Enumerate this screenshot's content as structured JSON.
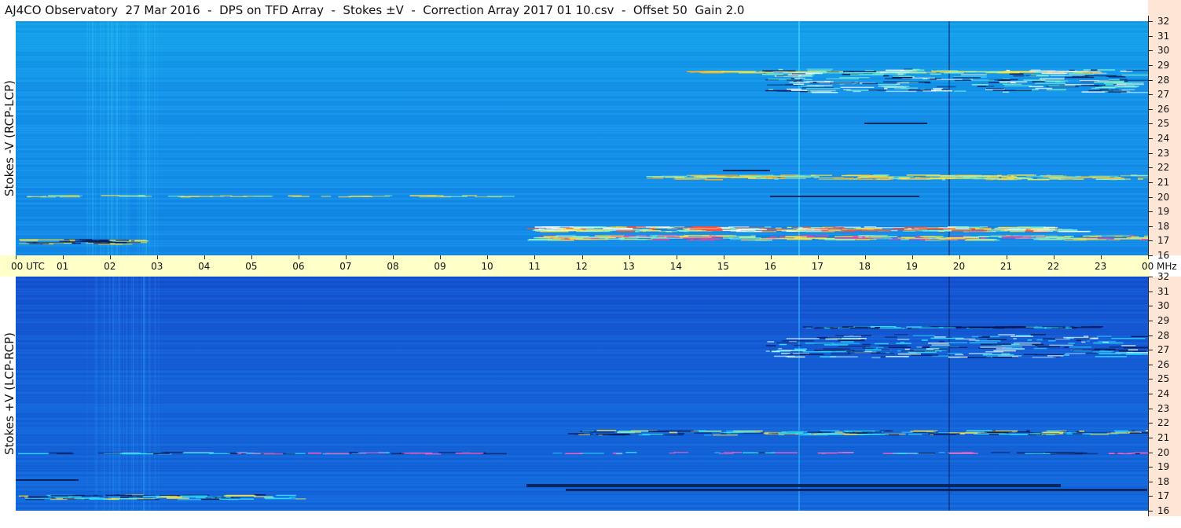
{
  "title": "AJ4CO Observatory  27 Mar 2016  -  DPS on TFD Array  -  Stokes ±V  -  Correction Array 2017 01 10.csv  -  Offset 50  Gain 2.0",
  "panels": {
    "top": {
      "ylabel": "Stokes -V (RCP-LCP)"
    },
    "bottom": {
      "ylabel": "Stokes +V (LCP-RCP)"
    }
  },
  "time_axis": {
    "labels": [
      "00 UTC",
      "01",
      "02",
      "03",
      "04",
      "05",
      "06",
      "07",
      "08",
      "09",
      "10",
      "11",
      "12",
      "13",
      "14",
      "15",
      "16",
      "17",
      "18",
      "19",
      "20",
      "21",
      "22",
      "23",
      "00"
    ],
    "unit_label": "MHz"
  },
  "frequency_axis": {
    "labels": [
      "32",
      "31",
      "30",
      "29",
      "28",
      "27",
      "26",
      "25",
      "24",
      "23",
      "22",
      "21",
      "20",
      "19",
      "18",
      "17",
      "16"
    ]
  },
  "colors": {
    "top_background": "#1590ea",
    "bottom_background": "#1560d8",
    "time_bar": "#ffffc8",
    "frequency_bar": "#fde6d6"
  }
}
